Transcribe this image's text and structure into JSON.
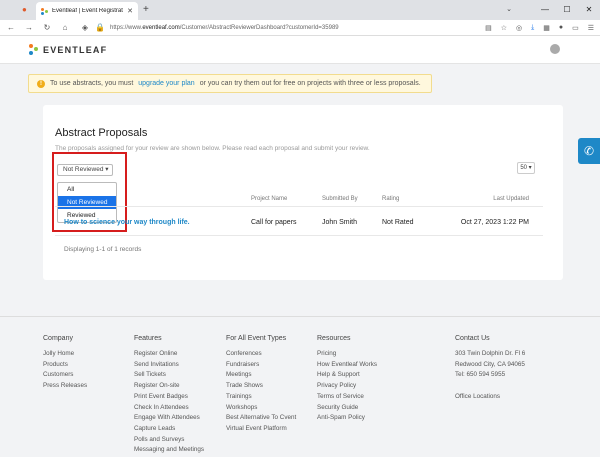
{
  "browser": {
    "tab_title": "Eventleaf | Event Registration Sof",
    "url_prefix": "https://www.",
    "url_domain": "eventleaf.com",
    "url_path": "/Customer/AbstractReviewerDashboard?customerId=35989"
  },
  "site": {
    "logo_text": "EVENTLEAF",
    "brand_colors": [
      "#f47b20",
      "#8cc63f",
      "#1e88c7"
    ]
  },
  "notice": {
    "icon": "warning-icon",
    "text_before": "To use abstracts, you must",
    "link_text": "upgrade your plan",
    "text_after": "or you can try them out for free on projects with three or less proposals."
  },
  "main": {
    "title": "Abstract Proposals",
    "subtitle": "The proposals assigned for your review are shown below. Please read each proposal and submit your review.",
    "filter": {
      "selected": "Not Reviewed",
      "options": [
        "All",
        "Not Reviewed",
        "Reviewed"
      ]
    },
    "page_size": "50",
    "columns": [
      "Project Name",
      "Submitted By",
      "Rating",
      "Last Updated"
    ],
    "rows": [
      {
        "title": "How to science your way through life.",
        "project": "Call for papers",
        "submitted_by": "John Smith",
        "rating": "Not Rated",
        "updated": "Oct 27, 2023 1:22 PM"
      }
    ],
    "displaying": "Displaying 1-1 of 1 records"
  },
  "footer": {
    "company": {
      "heading": "Company",
      "items": [
        "Jolly Home",
        "Products",
        "Customers",
        "Press Releases"
      ]
    },
    "features": {
      "heading": "Features",
      "items": [
        "Register Online",
        "Send Invitations",
        "Sell Tickets",
        "Register On-site",
        "Print Event Badges",
        "Check In Attendees",
        "Engage With Attendees",
        "Capture Leads",
        "Polls and Surveys",
        "Messaging and Meetings"
      ]
    },
    "event_types": {
      "heading": "For All Event Types",
      "items": [
        "Conferences",
        "Fundraisers",
        "Meetings",
        "Trade Shows",
        "Trainings",
        "Workshops",
        "Best Alternative To Cvent",
        "Virtual Event Platform"
      ]
    },
    "resources": {
      "heading": "Resources",
      "items": [
        "Pricing",
        "How Eventleaf Works",
        "Help & Support",
        "Privacy Policy",
        "Terms of Service",
        "Security Guide",
        "Anti-Spam Policy"
      ]
    },
    "contact": {
      "heading": "Contact Us",
      "items": [
        "303 Twin Dolphin Dr. Fl 6",
        "Redwood City, CA 94065",
        "Tel: 650 594 5955",
        "",
        "Office Locations"
      ]
    }
  }
}
